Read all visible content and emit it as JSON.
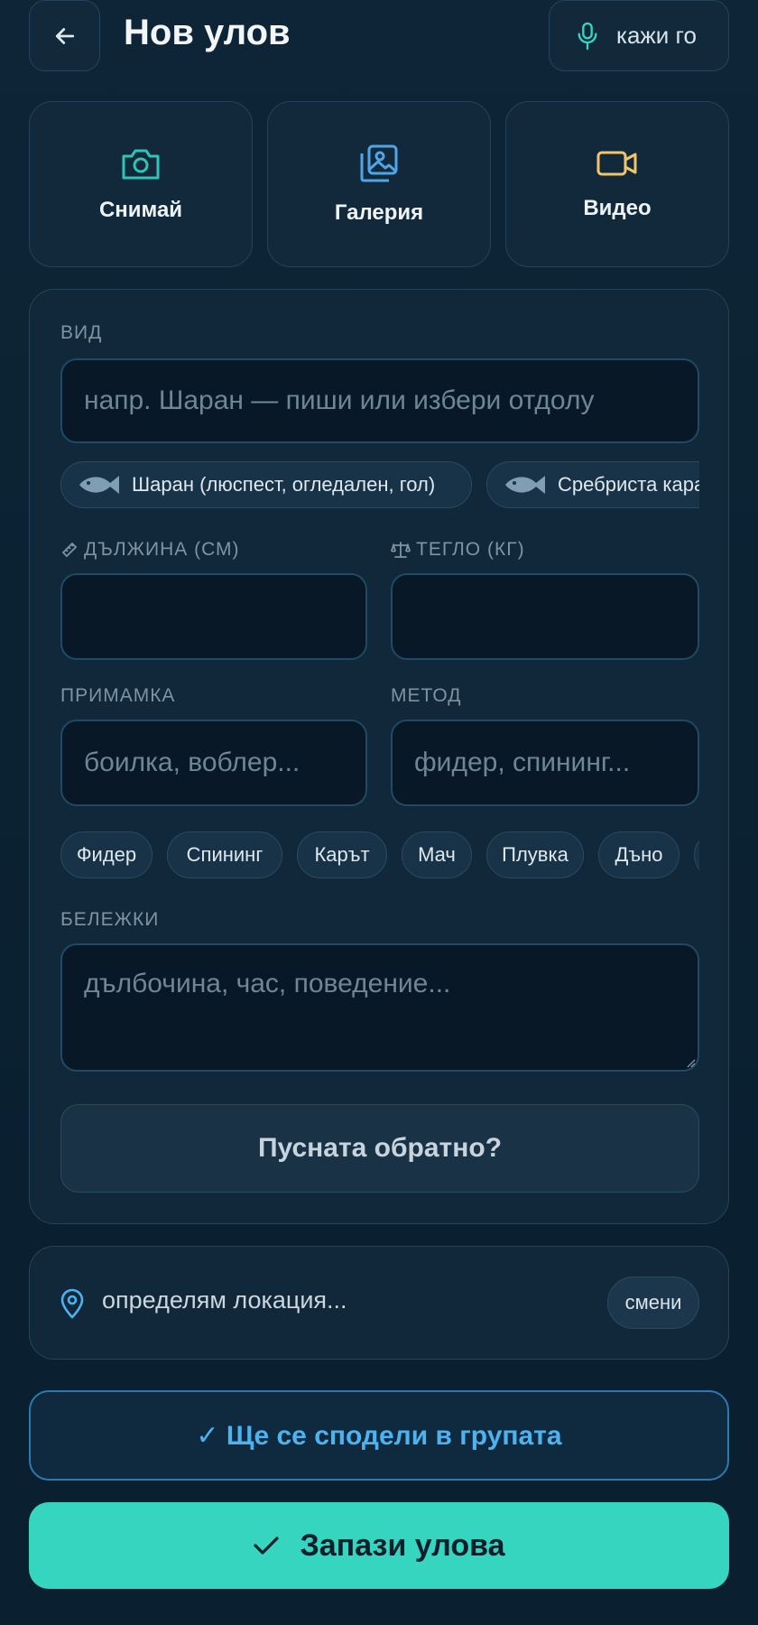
{
  "colors": {
    "accent_teal": "#36d5bf",
    "accent_blue": "#4cb2f0",
    "camera_icon": "#2ec4b6",
    "gallery_icon": "#4ea6e8",
    "video_icon": "#f2c56b"
  },
  "header": {
    "back_icon": "arrow-left-icon",
    "title": "Нов улов",
    "voice_icon": "microphone-icon",
    "voice_label": "кажи го"
  },
  "media": {
    "camera": {
      "icon": "camera-icon",
      "label": "Снимай"
    },
    "gallery": {
      "icon": "gallery-icon",
      "label": "Галерия"
    },
    "video": {
      "icon": "video-icon",
      "label": "Видео"
    }
  },
  "form": {
    "species_label": "ВИД",
    "species_placeholder": "напр. Шаран — пиши или избери отдолу",
    "species_chips": [
      {
        "icon": "fish-icon",
        "label": "Шаран (люспест, огледален, гол)"
      },
      {
        "icon": "fish-icon",
        "label": "Сребриста каракуда"
      }
    ],
    "length_icon": "ruler-icon",
    "length_label": "ДЪЛЖИНА (СМ)",
    "length_value": "",
    "weight_icon": "scale-icon",
    "weight_label": "ТЕГЛО (КГ)",
    "weight_value": "",
    "bait_label": "ПРИМАМКА",
    "bait_placeholder": "боилка, воблер...",
    "method_label": "МЕТОД",
    "method_placeholder": "фидер, спининг...",
    "method_chips": [
      "Фидер",
      "Спининг",
      "Карът",
      "Мач",
      "Плувка",
      "Дъно"
    ],
    "notes_label": "БЕЛЕЖКИ",
    "notes_placeholder": "дълбочина, час, поведение...",
    "released_label": "Пусната обратно?"
  },
  "location": {
    "icon": "map-pin-icon",
    "status": "определям локация...",
    "change_label": "смени"
  },
  "share": {
    "label": "✓ Ще се сподели в групата"
  },
  "save": {
    "icon": "check-icon",
    "label": "Запази улова"
  }
}
